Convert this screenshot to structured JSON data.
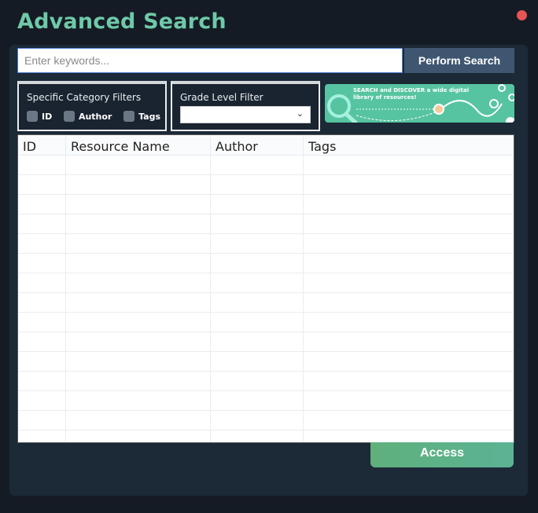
{
  "window": {
    "title": "Advanced Search",
    "close_color": "#e85454"
  },
  "search": {
    "placeholder": "Enter keywords...",
    "value": "",
    "button_label": "Perform Search"
  },
  "category_filters": {
    "label": "Specific Category Filters",
    "options": [
      {
        "label": "ID",
        "checked": false
      },
      {
        "label": "Author",
        "checked": false
      },
      {
        "label": "Tags",
        "checked": false
      }
    ]
  },
  "grade_filter": {
    "label": "Grade Level Filter",
    "selected": ""
  },
  "banner": {
    "text": "SEARCH and DISCOVER a wide digital library of resources!"
  },
  "results_table": {
    "columns": [
      "ID",
      "Resource Name",
      "Author",
      "Tags"
    ],
    "rows": []
  },
  "access_button": {
    "label": "Access"
  },
  "colors": {
    "accent": "#6fc9a8",
    "panel": "#1c2936",
    "background": "#151b24",
    "button": "#3e5670"
  }
}
